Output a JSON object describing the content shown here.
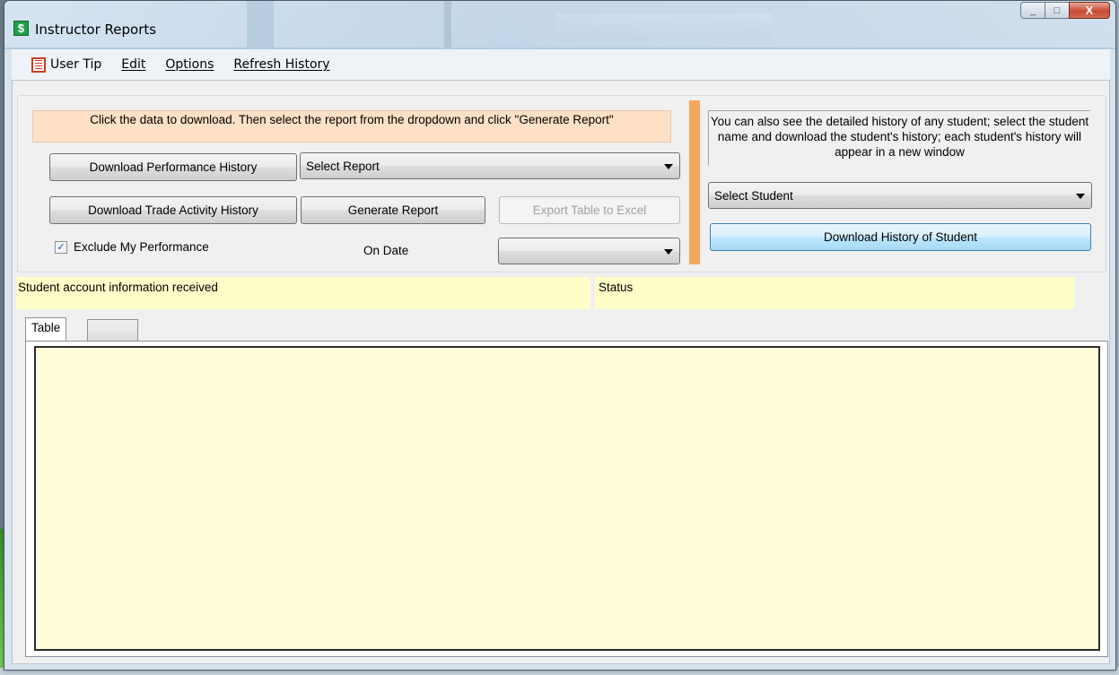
{
  "window": {
    "title": "Instructor Reports",
    "app_icon_glyph": "$",
    "close_glyph": "X",
    "min_glyph": "_",
    "max_glyph": "□"
  },
  "menu": {
    "user_tip": "User Tip",
    "edit": "Edit",
    "options": "Options",
    "refresh_history": "Refresh History"
  },
  "left_panel": {
    "instructions": "Click the data to download.  Then select the report from the dropdown and click \"Generate Report\"",
    "download_performance_label": "Download Performance History",
    "download_trade_label": "Download Trade Activity History",
    "report_select_value": "Select Report",
    "generate_report_label": "Generate Report",
    "export_excel_label": "Export Table to Excel",
    "exclude_checkbox_label": "Exclude My Performance",
    "exclude_checked": true,
    "on_date_label": "On Date",
    "date_select_value": ""
  },
  "right_panel": {
    "instructions": "You can also see the detailed history of any student; select the student name and download the student's history; each student's history will appear in a new window",
    "student_select_value": "Select Student",
    "download_student_label": "Download History of Student"
  },
  "status": {
    "left_message": "Student account information received",
    "right_message": "Status"
  },
  "tabs": [
    {
      "label": "Table",
      "active": true
    },
    {
      "label": "",
      "active": false
    }
  ],
  "colors": {
    "instruction_banner": "#fde0c6",
    "divider_orange": "#f4a85d",
    "status_yellow": "#fffec8",
    "table_yellow": "#fffed8"
  },
  "icons": {
    "app": "dollar-app-icon",
    "user_tip": "document-list-icon",
    "combo": "chevron-down-icon"
  }
}
